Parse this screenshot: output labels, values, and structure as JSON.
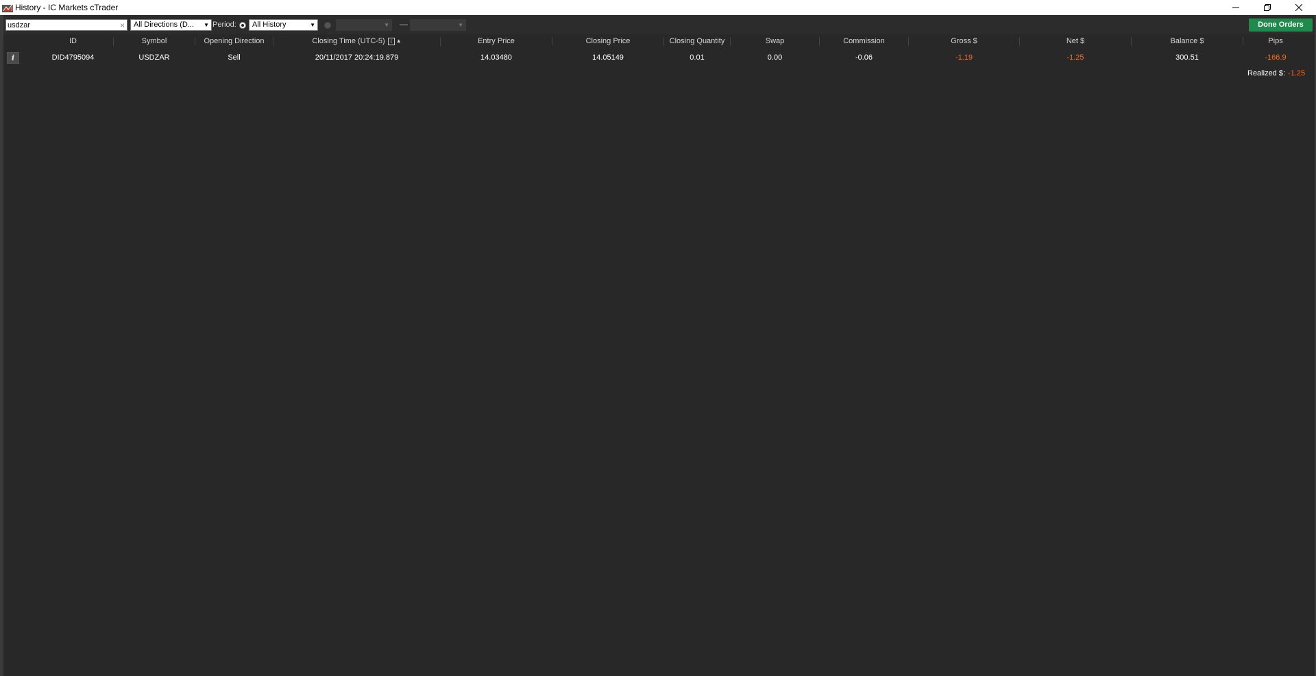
{
  "window": {
    "title": "History - IC Markets cTrader",
    "minimize": "—",
    "maximize": "❐",
    "close": "✕"
  },
  "toolbar": {
    "search_value": "usdzar",
    "search_clear": "×",
    "directions_selected": "All Directions (D...",
    "period_label": "Period:",
    "period_selected": "All History",
    "from_value": "",
    "to_value": "",
    "range_dash": "—",
    "done_orders_label": "Done Orders"
  },
  "table": {
    "columns": [
      "ID",
      "Symbol",
      "Opening Direction",
      "Closing Time (UTC-5)",
      "Entry Price",
      "Closing Price",
      "Closing Quantity",
      "Swap",
      "Commission",
      "Gross $",
      "Net $",
      "Balance $",
      "Pips"
    ],
    "sort_icon": "i",
    "sort_arrow": "▲",
    "rows": [
      {
        "info": "i",
        "id": "DID4795094",
        "symbol": "USDZAR",
        "direction": "Sell",
        "closing_time": "20/11/2017 20:24:19.879",
        "entry_price": "14.03480",
        "closing_price": "14.05149",
        "closing_quantity": "0.01",
        "swap": "0.00",
        "commission": "-0.06",
        "gross": "-1.19",
        "net": "-1.25",
        "balance": "300.51",
        "pips": "-166.9"
      }
    ]
  },
  "summary": {
    "realized_label": "Realized $:",
    "realized_value": "-1.25"
  },
  "colors": {
    "background": "#282828",
    "negative": "#ff6a1a",
    "done_button": "#1f8a4c"
  }
}
